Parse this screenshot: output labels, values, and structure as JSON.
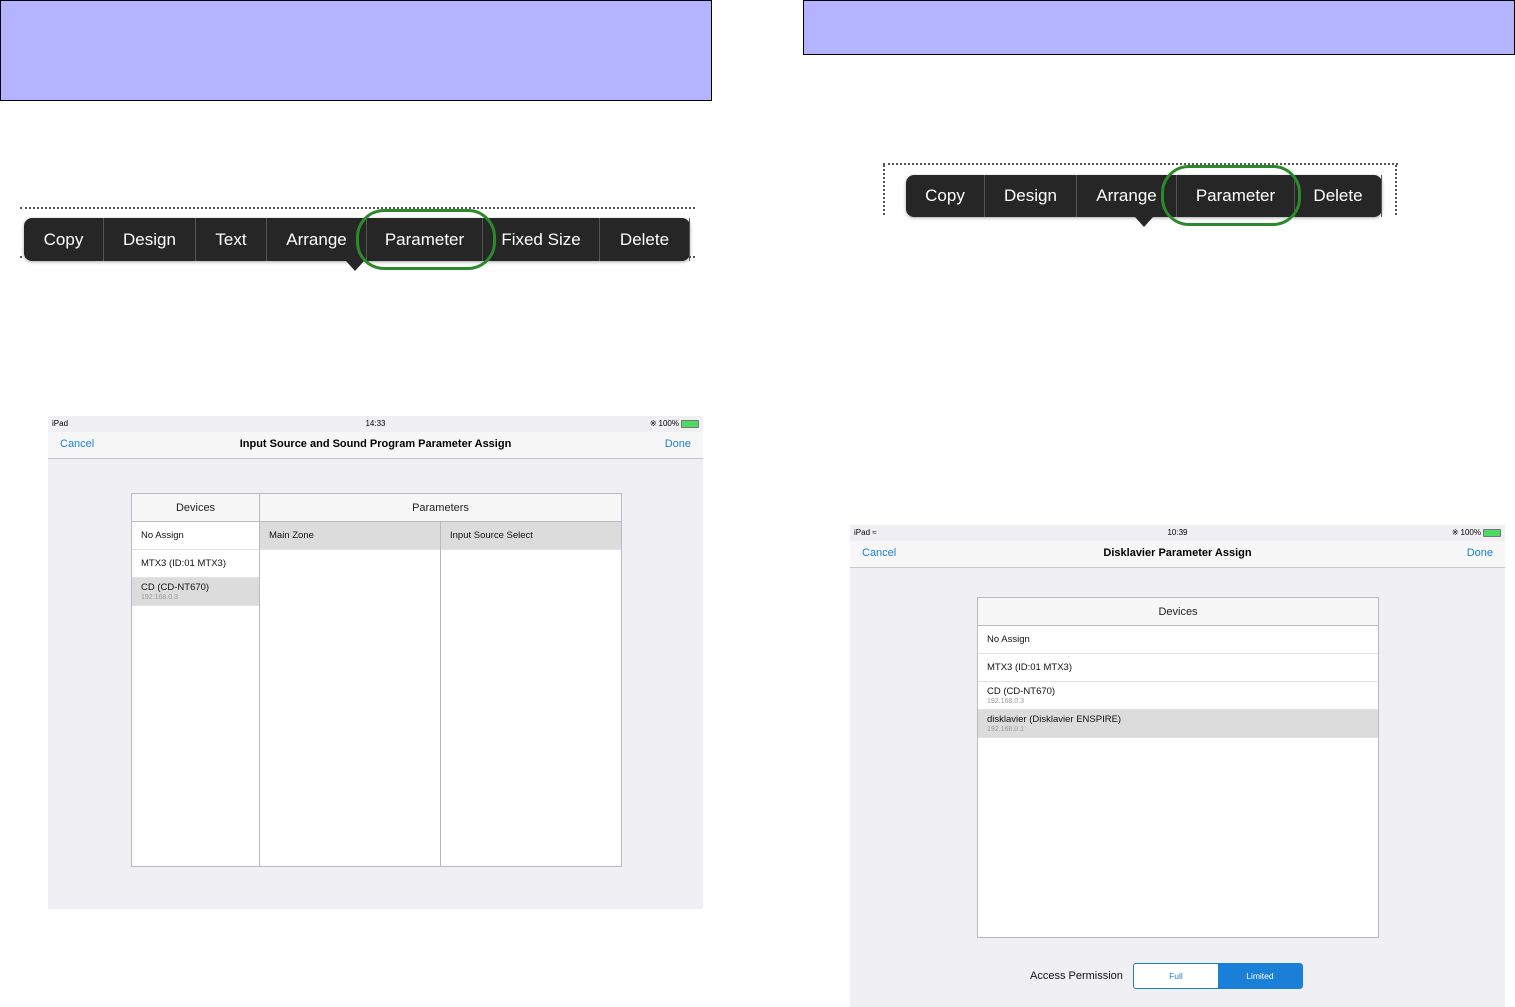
{
  "left": {
    "menu": [
      "Copy",
      "Design",
      "Text",
      "Arrange",
      "Parameter",
      "Fixed Size",
      "Delete"
    ],
    "highlighted": "Parameter",
    "ipad": {
      "status": {
        "carrier": "iPad",
        "time": "14:33",
        "battery": "100%"
      },
      "nav": {
        "cancel": "Cancel",
        "title": "Input Source and Sound Program Parameter Assign",
        "done": "Done"
      },
      "devices_header": "Devices",
      "parameters_header": "Parameters",
      "devices": [
        {
          "name": "No Assign",
          "ip": ""
        },
        {
          "name": "MTX3 (ID:01 MTX3)",
          "ip": ""
        },
        {
          "name": "CD (CD-NT670)",
          "ip": "192.168.0.3",
          "selected": true
        }
      ],
      "param_col1": [
        "Main Zone"
      ],
      "param_col2": [
        "Input Source Select"
      ]
    }
  },
  "right": {
    "menu": [
      "Copy",
      "Design",
      "Arrange",
      "Parameter",
      "Delete"
    ],
    "highlighted": "Parameter",
    "ipad": {
      "status": {
        "carrier": "iPad",
        "time": "10:39",
        "battery": "100%"
      },
      "nav": {
        "cancel": "Cancel",
        "title": "Disklavier Parameter Assign",
        "done": "Done"
      },
      "devices_header": "Devices",
      "devices": [
        {
          "name": "No Assign",
          "ip": ""
        },
        {
          "name": "MTX3 (ID:01 MTX3)",
          "ip": ""
        },
        {
          "name": "CD (CD-NT670)",
          "ip": "192.168.0.3"
        },
        {
          "name": "disklavier (Disklavier ENSPIRE)",
          "ip": "192.168.0.1",
          "selected": true
        }
      ],
      "access_permission": {
        "label": "Access Permission",
        "options": [
          "Full",
          "Limited"
        ],
        "selected": "Limited"
      }
    }
  },
  "colors": {
    "banner": "#b3b3ff",
    "highlight": "#2b8a2b",
    "ios_blue": "#1a7fd6",
    "menu_bg": "#262626"
  }
}
